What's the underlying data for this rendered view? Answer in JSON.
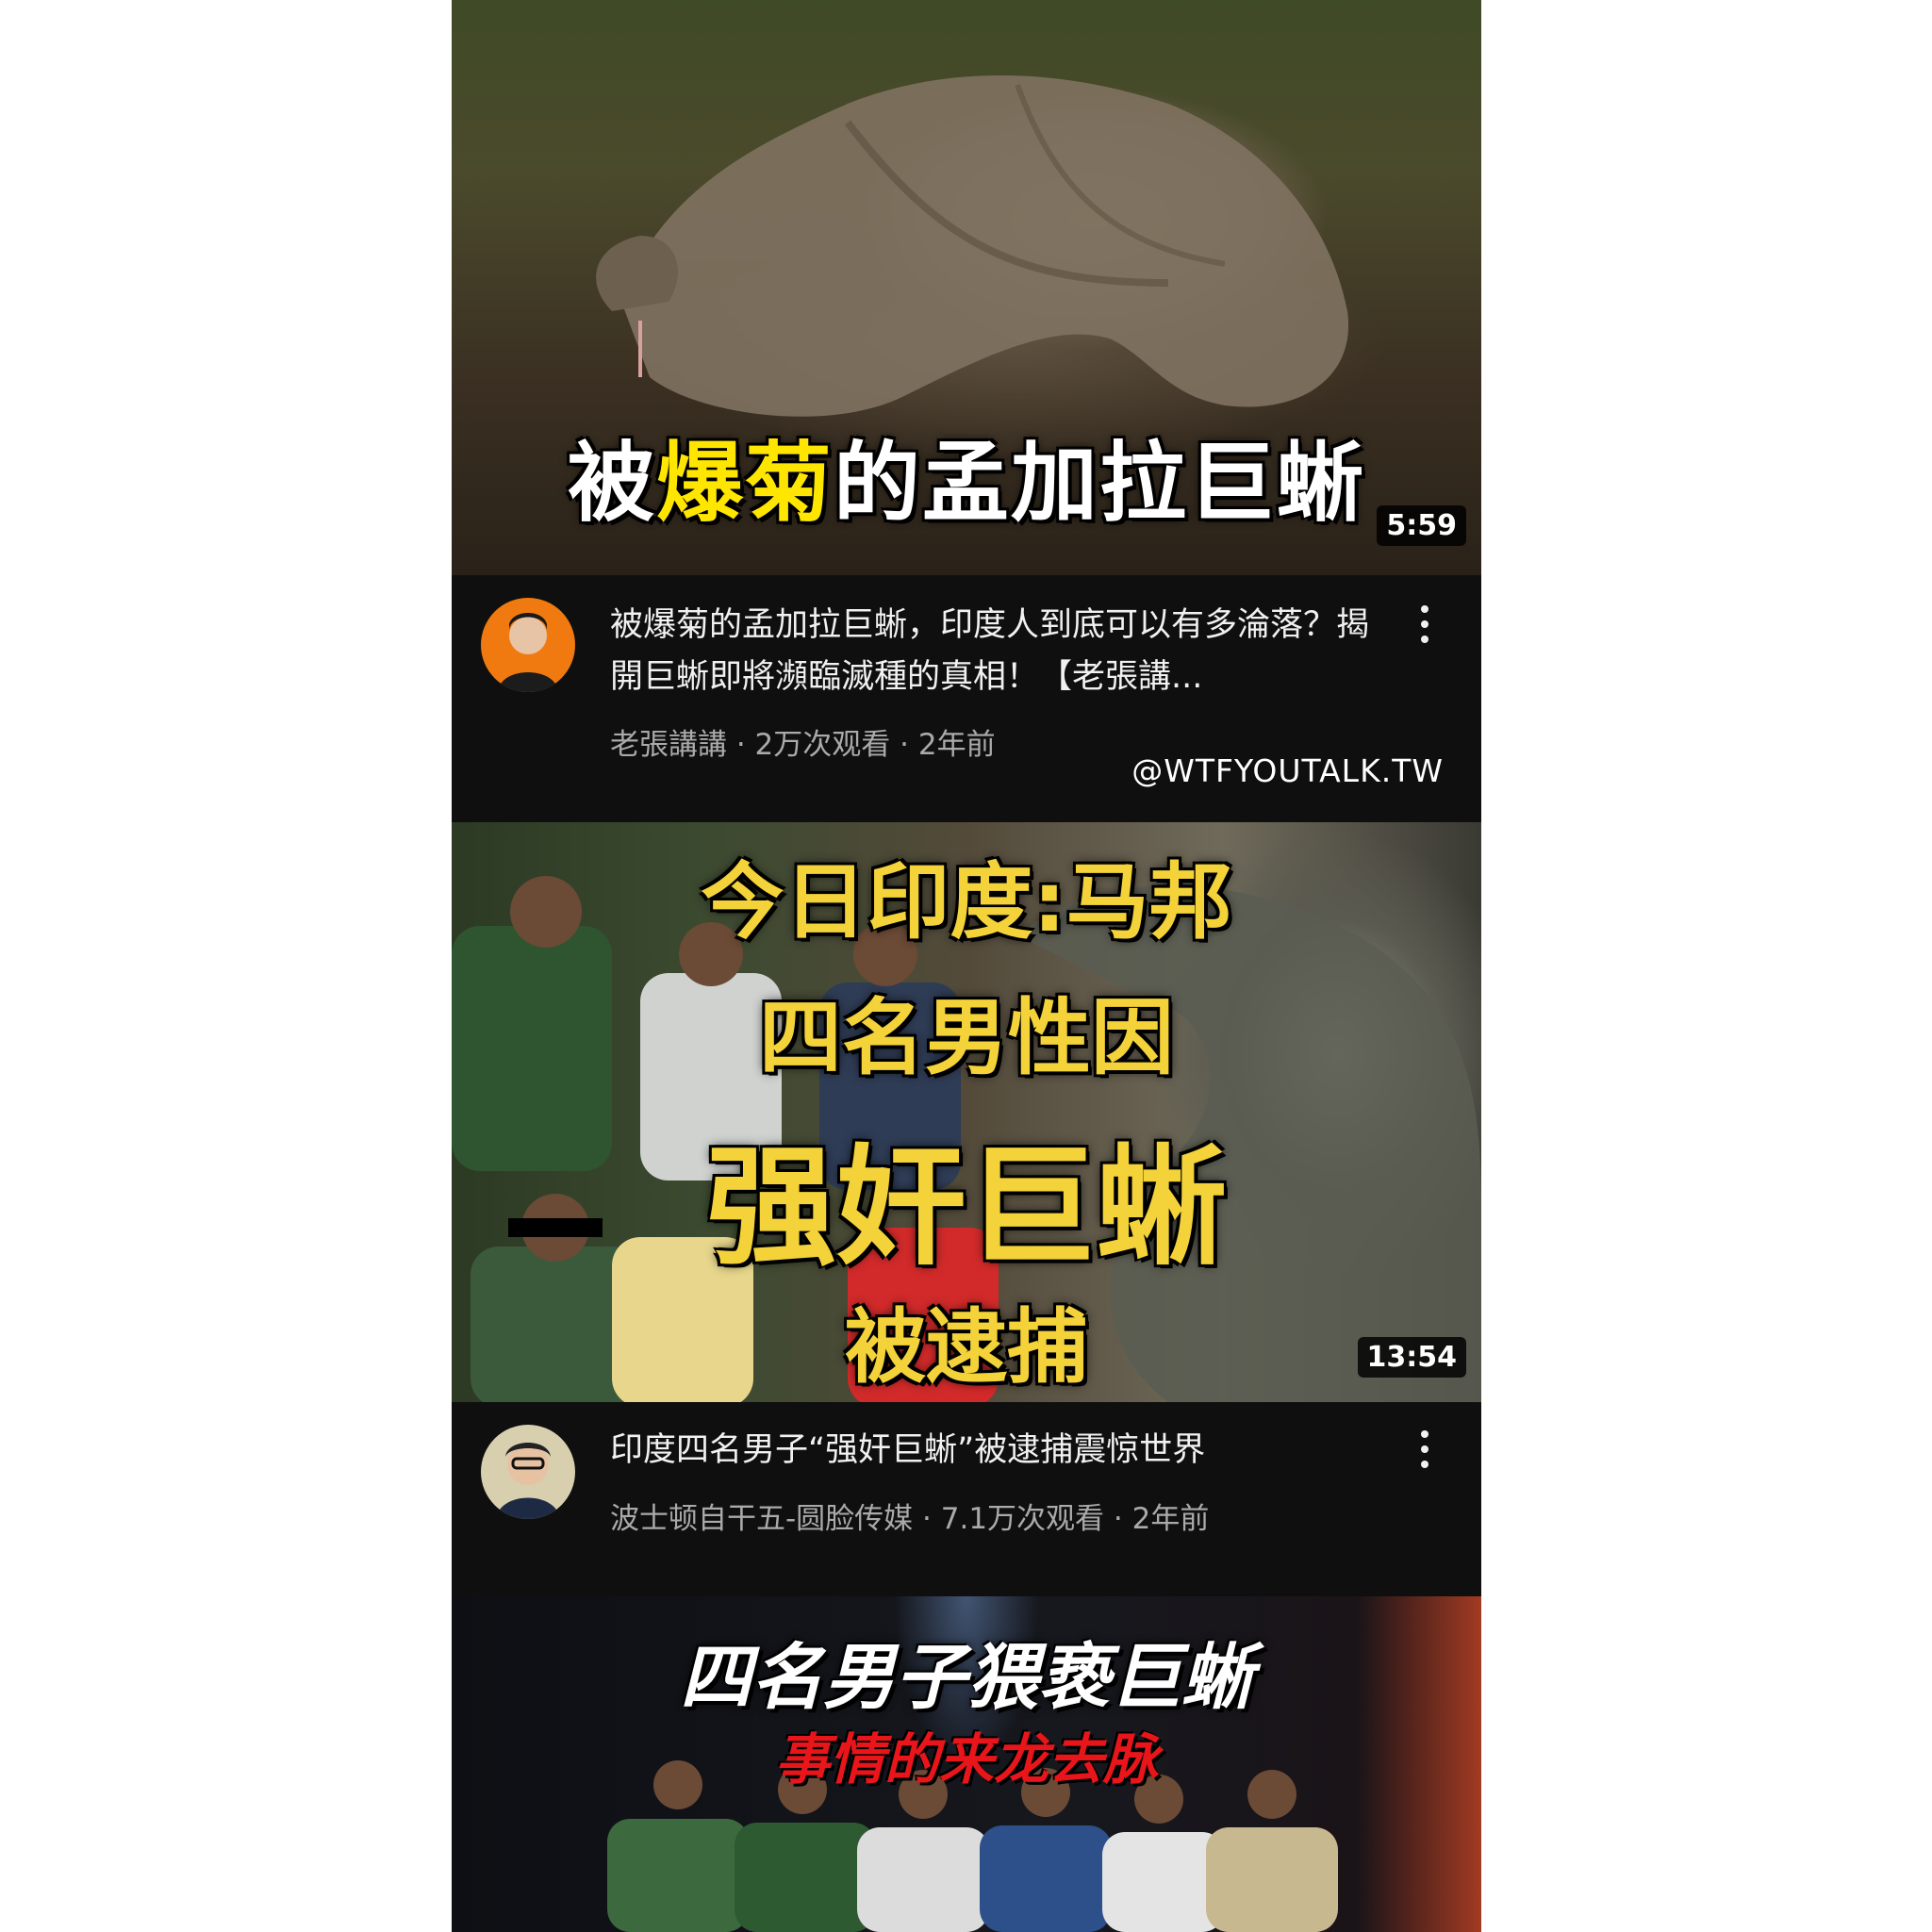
{
  "watermark": "@WTFYOUTALK.TW",
  "videos": [
    {
      "thumb_text_a": "被",
      "thumb_text_b": "爆菊",
      "thumb_text_c": "的孟加拉巨蜥",
      "duration": "5:59",
      "title": "被爆菊的孟加拉巨蜥，印度人到底可以有多淪落？揭開巨蜥即將瀕臨滅種的真相！【老張講...",
      "channel": "老張講講",
      "views": "2万次观看",
      "age": "2年前",
      "sub_line": "老張講講 · 2万次观看 · 2年前"
    },
    {
      "thumb_lines": [
        "今日印度:马邦",
        "四名男性因",
        "强奸巨蜥",
        "被逮捕"
      ],
      "duration": "13:54",
      "title": "印度四名男子“强奸巨蜥”被逮捕震惊世界",
      "channel": "波士顿自干五-圆脸传媒",
      "views": "7.1万次观看",
      "age": "2年前",
      "sub_line": "波士顿自干五-圆脸传媒 · 7.1万次观看 · 2年前"
    },
    {
      "thumb_title": "四名男子猥亵巨蜥",
      "thumb_subtitle": "事情的来龙去脉"
    }
  ],
  "icons": {
    "menu": "more-vert-icon"
  },
  "colors": {
    "background": "#0f0f0f",
    "highlight_yellow": "#ffe600",
    "thumb_gold": "#f3d23a",
    "subtitle_red": "#e8151b"
  }
}
